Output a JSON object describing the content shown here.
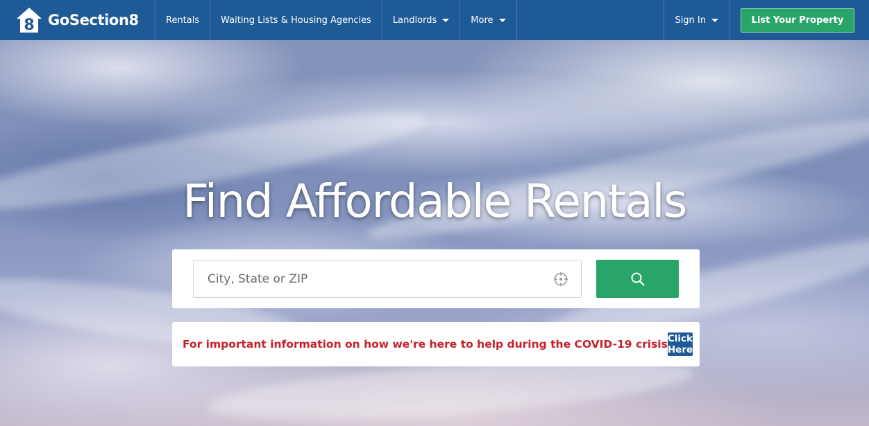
{
  "brand": {
    "name": "GoSection8",
    "logo_digit": "8"
  },
  "nav": {
    "items": [
      {
        "label": "Rentals",
        "dropdown": false
      },
      {
        "label": "Waiting Lists & Housing Agencies",
        "dropdown": false
      },
      {
        "label": "Landlords",
        "dropdown": true
      },
      {
        "label": "More",
        "dropdown": true
      }
    ],
    "sign_in": "Sign In",
    "list_property": "List Your Property"
  },
  "hero": {
    "headline": "Find Affordable Rentals",
    "search": {
      "placeholder": "City, State or ZIP",
      "value": "",
      "locate_icon": "crosshair-icon",
      "button_icon": "search-icon"
    }
  },
  "notice": {
    "text": "For important information on how we're here to help during the COVID-19 crisis",
    "button": "Click Here"
  },
  "colors": {
    "nav_bg": "#1e5a96",
    "accent_green": "#2aa56a",
    "alert_red": "#c7202a",
    "button_blue": "#1e5a96"
  }
}
